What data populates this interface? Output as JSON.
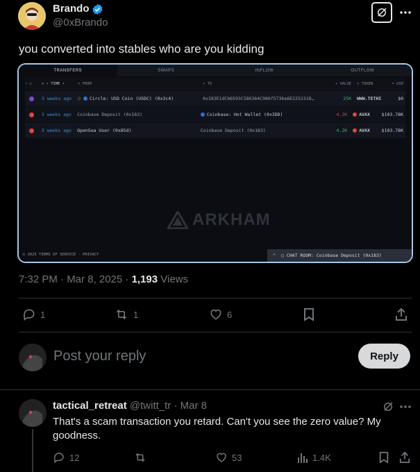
{
  "post": {
    "author_name": "Brando",
    "author_handle": "@0xBrando",
    "text": "you converted into stables who are you kidding",
    "time": "7:32 PM · Mar 8, 2025 · ",
    "views_count": "1,193",
    "views_label": "Views",
    "replies": "1",
    "reposts": "1",
    "likes": "6"
  },
  "screenshot": {
    "tabs": [
      "TRANSFERS",
      "SWAPS",
      "INFLOW",
      "OUTFLOW"
    ],
    "columns": {
      "time": "TIME",
      "from": "FROM",
      "to": "TO",
      "value": "VALUE",
      "token": "TOKEN",
      "usd": "USD"
    },
    "rows": [
      {
        "time": "3 weeks ago",
        "from": "Circle: USD Coin (USDC) (0x3c4)",
        "to": "0x183E1dC66593C586364C966f573be6E2252318…",
        "value": "25K",
        "token": "WWW.TETHI",
        "usd": "$0"
      },
      {
        "time": "3 weeks ago",
        "from": "Coinbase Deposit (0x183)",
        "to": "Coinbase: Hot Wallet (0x3DD)",
        "value": "4.2K",
        "token": "AVAX",
        "usd": "$103.78K"
      },
      {
        "time": "3 weeks ago",
        "from": "OpenSea User (0x85d)",
        "to": "Coinbase Deposit (0x183)",
        "value": "4.2K",
        "token": "AVAX",
        "usd": "$103.78K"
      }
    ],
    "watermark": "ARKHAM",
    "footer_left": "© 2025   TERMS OF SERVICE · PRIVACY",
    "chat_room": "CHAT ROOM: Coinbase Deposit (0x183)",
    "colors": {
      "from_icon_1": "#7b4ad9",
      "token_red": "#e84142",
      "value_green": "#3fb56a",
      "time_blue": "#3a8fe0"
    }
  },
  "composer": {
    "placeholder": "Post your reply",
    "reply_label": "Reply"
  },
  "reply": {
    "author_name": "tactical_retreat",
    "author_handle": "@twitt_tr",
    "date": "· Mar 8",
    "text": "That's a scam transaction you retard. Can't you see the zero value? My goodness.",
    "replies": "12",
    "likes": "53",
    "views": "1.4K"
  }
}
